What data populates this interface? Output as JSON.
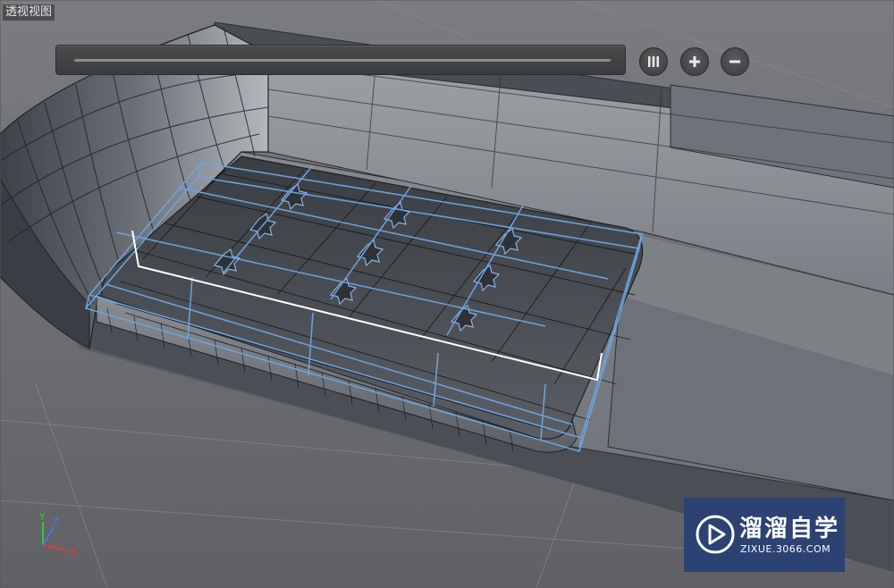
{
  "viewport": {
    "label": "透视视图",
    "accent_selection_color": "#6fa3e0"
  },
  "timeline": {
    "controls": [
      {
        "name": "pause",
        "icon": "pause-icon"
      },
      {
        "name": "zoom-in",
        "icon": "plus-icon"
      },
      {
        "name": "zoom-out",
        "icon": "minus-icon"
      }
    ]
  },
  "axis": {
    "x": "X",
    "y": "Y",
    "z": "Z"
  },
  "watermark": {
    "title": "溜溜自学",
    "subtitle": "ZIXUE.3066.COM",
    "icon": "play-logo-icon"
  }
}
